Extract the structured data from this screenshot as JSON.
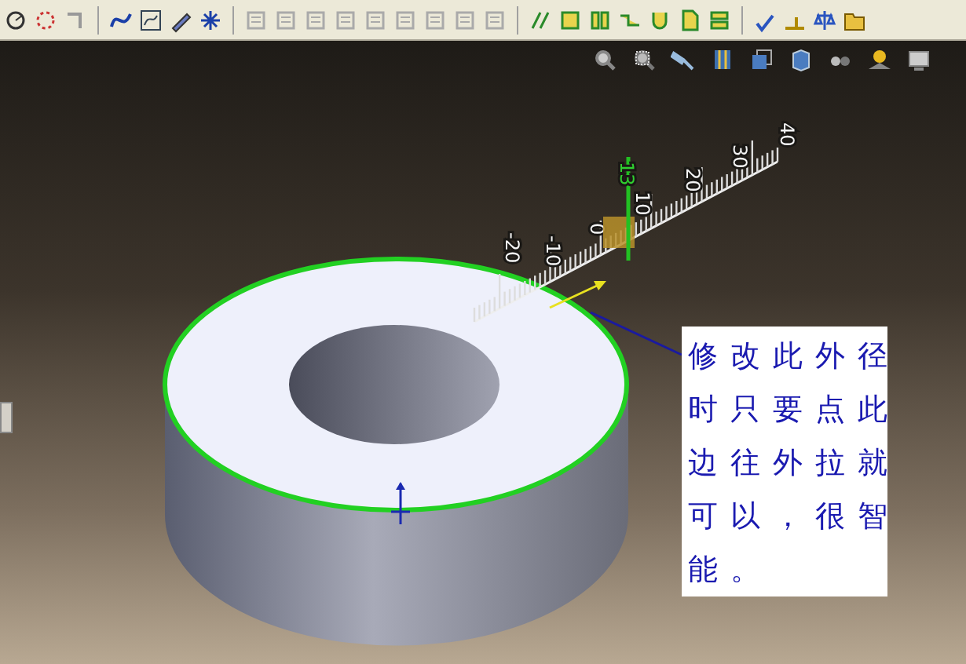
{
  "ruler": {
    "labels": [
      "-20",
      "-10",
      "0",
      "10",
      "20",
      "30",
      "40"
    ],
    "current_value": "13"
  },
  "note": {
    "text": "修改此外径时只要点此边往外拉就可以，很智能。"
  }
}
